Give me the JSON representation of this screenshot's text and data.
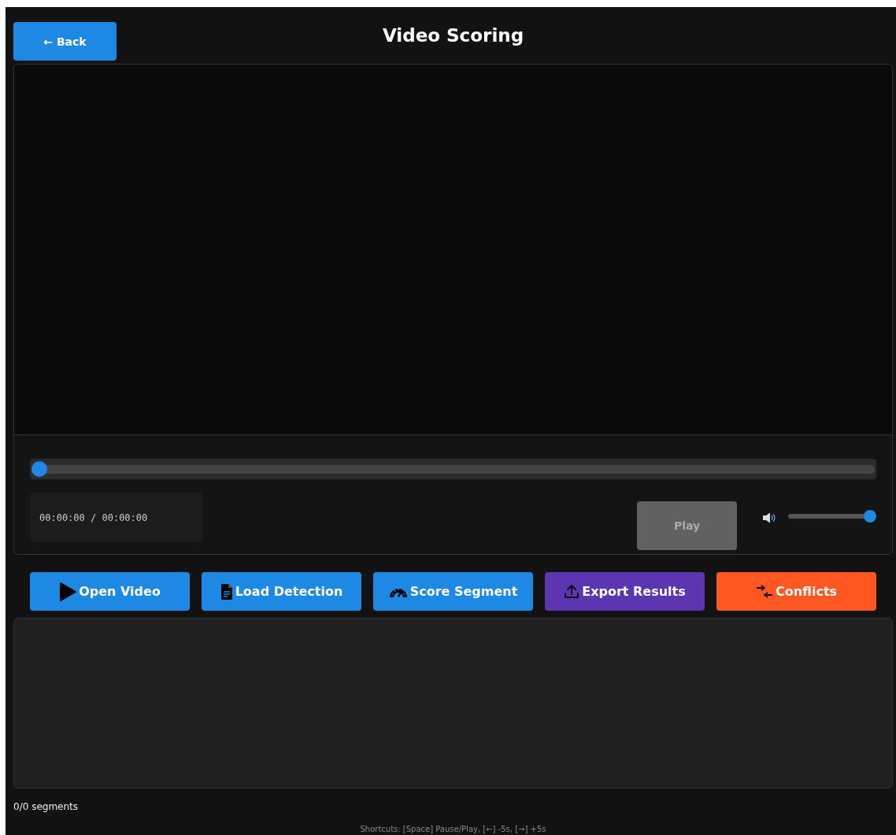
{
  "header": {
    "back_button": "← Back",
    "title": "Video Scoring"
  },
  "player": {
    "seek": {
      "level": 0
    },
    "time": "00:00:00 / 00:00:00",
    "play_button": {
      "label": "Play",
      "disabled": true
    },
    "volume": {
      "level": 1
    }
  },
  "actions": [
    {
      "label": "Open Video",
      "kind": "play",
      "color": "#1e88e5"
    },
    {
      "label": "Load Detection",
      "kind": "file",
      "color": "#1e88e5"
    },
    {
      "label": "Score Segment",
      "kind": "gauge",
      "color": "#1e88e5"
    },
    {
      "label": "Export Results",
      "kind": "upload",
      "color": "#5e35b1"
    },
    {
      "label": "Conflicts",
      "kind": "arrows",
      "color": "#ff5722"
    }
  ],
  "segment_count": "0/0 segments",
  "shortcuts": "Shortcuts: [Space] Pause/Play, [←] -5s, [→] +5s"
}
